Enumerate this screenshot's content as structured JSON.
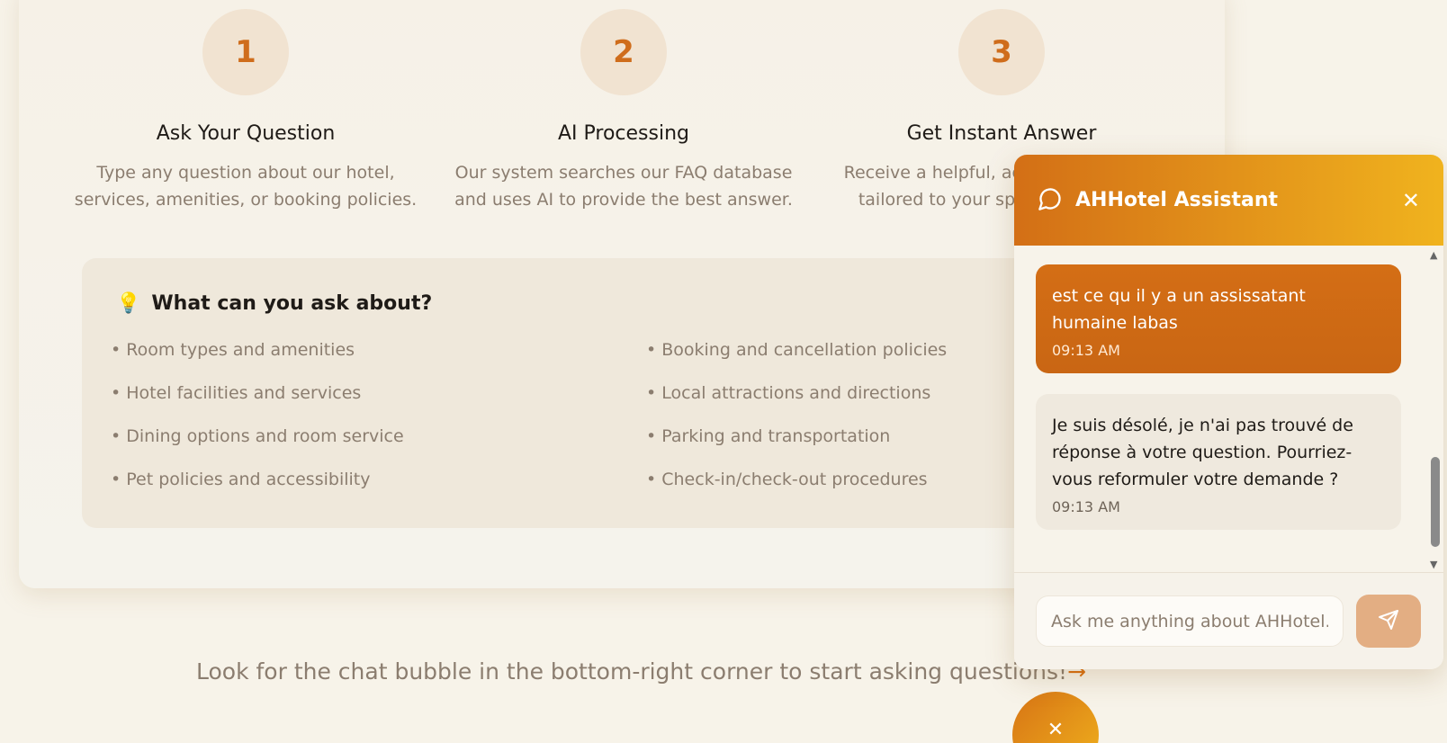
{
  "steps": [
    {
      "number": "1",
      "title": "Ask Your Question",
      "desc_line1": "Type any question about our hotel,",
      "desc_line2": "services, amenities, or booking policies."
    },
    {
      "number": "2",
      "title": "AI Processing",
      "desc_line1": "Our system searches our FAQ database",
      "desc_line2": "and uses AI to provide the best answer."
    },
    {
      "number": "3",
      "title": "Get Instant Answer",
      "desc_line1": "Receive a helpful, accurate response",
      "desc_line2": "tailored to your specific question."
    }
  ],
  "ask": {
    "icon": "lightbulb-icon",
    "emoji": "💡",
    "title": "What can you ask about?",
    "left": [
      "• Room types and amenities",
      "• Hotel facilities and services",
      "• Dining options and room service",
      "• Pet policies and accessibility"
    ],
    "right": [
      "• Booking and cancellation policies",
      "• Local attractions and directions",
      "• Parking and transportation",
      "• Check-in/check-out procedures"
    ]
  },
  "hint": {
    "text": "Look for the chat bubble in the bottom-right corner to start asking questions!",
    "arrow": "→"
  },
  "chat": {
    "title": "AHHotel Assistant",
    "close_symbol": "✕",
    "messages": [
      {
        "role": "user",
        "text": "est ce qu il y a un assissatant humaine labas",
        "time": "09:13 AM"
      },
      {
        "role": "bot",
        "text": "Je suis désolé, je n'ai pas trouvé de réponse à votre question. Pourriez-vous reformuler votre demande ?",
        "time": "09:13 AM"
      }
    ],
    "input_placeholder": "Ask me anything about AHHotel...",
    "send_icon": "send-icon"
  },
  "fab": {
    "symbol": "✕",
    "icon": "close-icon"
  },
  "colors": {
    "accent": "#d96f10",
    "accent_light": "#f0b31e",
    "step_circle": "#f1e3d1",
    "muted_text": "#8b7d6f"
  }
}
